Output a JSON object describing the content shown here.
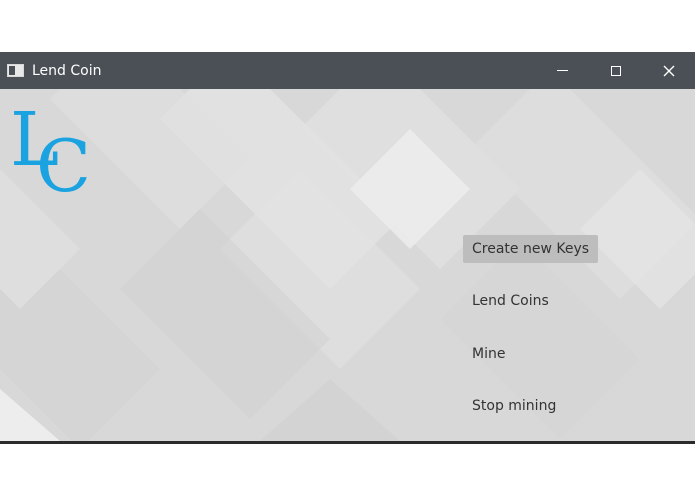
{
  "window": {
    "title": "Lend Coin",
    "controls": {
      "minimize": "minimize-icon",
      "maximize": "maximize-icon",
      "close": "close-icon"
    }
  },
  "logo": {
    "letters": "LC",
    "color": "#1aa3e0"
  },
  "menu": {
    "create_keys": "Create new Keys",
    "lend_coins": "Lend Coins",
    "mine": "Mine",
    "stop_mining": "Stop mining"
  },
  "colors": {
    "titlebar": "#4a5056",
    "background": "#dcdcdc",
    "active_button": "#bdbdbd"
  }
}
